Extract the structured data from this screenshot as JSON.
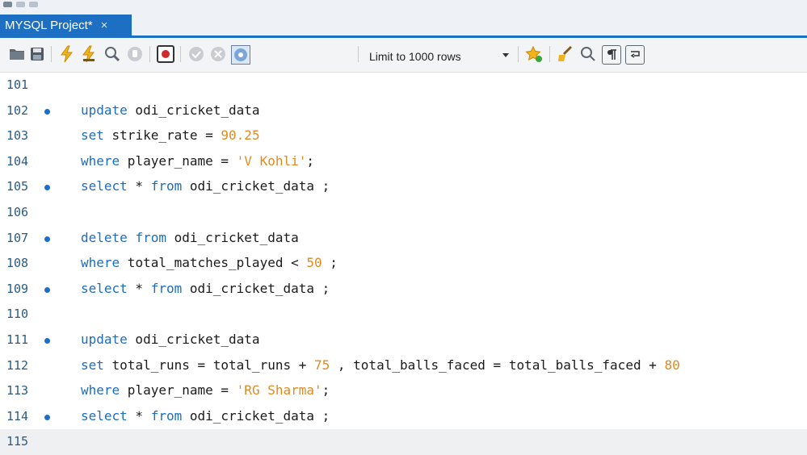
{
  "tab": {
    "title": "MYSQL Project*",
    "close": "×"
  },
  "toolbar": {
    "limit_label": "Limit to 1000 rows",
    "icons": [
      "open-folder-icon",
      "save-icon",
      "execute-lightning-icon",
      "execute-statement-icon",
      "explain-magnifier-icon",
      "stop-icon",
      "toggle-error-icon",
      "commit-icon",
      "rollback-icon",
      "autocommit-toggle-icon",
      "bookmark-star-icon",
      "beautify-broom-icon",
      "find-icon",
      "invisible-chars-icon",
      "word-wrap-icon"
    ]
  },
  "editor": {
    "lines": [
      {
        "number": "101",
        "dot": false,
        "tokens": []
      },
      {
        "number": "102",
        "dot": true,
        "tokens": [
          {
            "t": "kw",
            "v": "update"
          },
          {
            "t": "op",
            "v": " odi_cricket_data"
          }
        ]
      },
      {
        "number": "103",
        "dot": false,
        "tokens": [
          {
            "t": "kw",
            "v": "set"
          },
          {
            "t": "op",
            "v": " strike_rate = "
          },
          {
            "t": "num",
            "v": "90.25"
          }
        ]
      },
      {
        "number": "104",
        "dot": false,
        "tokens": [
          {
            "t": "kw",
            "v": "where"
          },
          {
            "t": "op",
            "v": " player_name = "
          },
          {
            "t": "str",
            "v": "'V Kohli'"
          },
          {
            "t": "op",
            "v": ";"
          }
        ]
      },
      {
        "number": "105",
        "dot": true,
        "tokens": [
          {
            "t": "kw",
            "v": "select"
          },
          {
            "t": "op",
            "v": " * "
          },
          {
            "t": "kw",
            "v": "from"
          },
          {
            "t": "op",
            "v": " odi_cricket_data ;"
          }
        ]
      },
      {
        "number": "106",
        "dot": false,
        "tokens": []
      },
      {
        "number": "107",
        "dot": true,
        "tokens": [
          {
            "t": "kw",
            "v": "delete"
          },
          {
            "t": "op",
            "v": " "
          },
          {
            "t": "kw",
            "v": "from"
          },
          {
            "t": "op",
            "v": " odi_cricket_data"
          }
        ]
      },
      {
        "number": "108",
        "dot": false,
        "tokens": [
          {
            "t": "kw",
            "v": "where"
          },
          {
            "t": "op",
            "v": " total_matches_played < "
          },
          {
            "t": "num",
            "v": "50"
          },
          {
            "t": "op",
            "v": " ;"
          }
        ]
      },
      {
        "number": "109",
        "dot": true,
        "tokens": [
          {
            "t": "kw",
            "v": "select"
          },
          {
            "t": "op",
            "v": " * "
          },
          {
            "t": "kw",
            "v": "from"
          },
          {
            "t": "op",
            "v": " odi_cricket_data ;"
          }
        ]
      },
      {
        "number": "110",
        "dot": false,
        "tokens": []
      },
      {
        "number": "111",
        "dot": true,
        "tokens": [
          {
            "t": "kw",
            "v": "update"
          },
          {
            "t": "op",
            "v": " odi_cricket_data"
          }
        ]
      },
      {
        "number": "112",
        "dot": false,
        "tokens": [
          {
            "t": "kw",
            "v": "set"
          },
          {
            "t": "op",
            "v": " total_runs = total_runs + "
          },
          {
            "t": "num",
            "v": "75"
          },
          {
            "t": "op",
            "v": " , total_balls_faced = total_balls_faced + "
          },
          {
            "t": "num",
            "v": "80"
          }
        ]
      },
      {
        "number": "113",
        "dot": false,
        "tokens": [
          {
            "t": "kw",
            "v": "where"
          },
          {
            "t": "op",
            "v": " player_name = "
          },
          {
            "t": "str",
            "v": "'RG Sharma'"
          },
          {
            "t": "op",
            "v": ";"
          }
        ]
      },
      {
        "number": "114",
        "dot": true,
        "tokens": [
          {
            "t": "kw",
            "v": "select"
          },
          {
            "t": "op",
            "v": " * "
          },
          {
            "t": "kw",
            "v": "from"
          },
          {
            "t": "op",
            "v": " odi_cricket_data ;"
          }
        ]
      },
      {
        "number": "115",
        "dot": false,
        "current": true,
        "tokens": []
      }
    ]
  },
  "colors": {
    "accent": "#1d6fc4",
    "keyword": "#1b6dc1",
    "number": "#e08a1e",
    "line_number": "#2a5b86"
  }
}
